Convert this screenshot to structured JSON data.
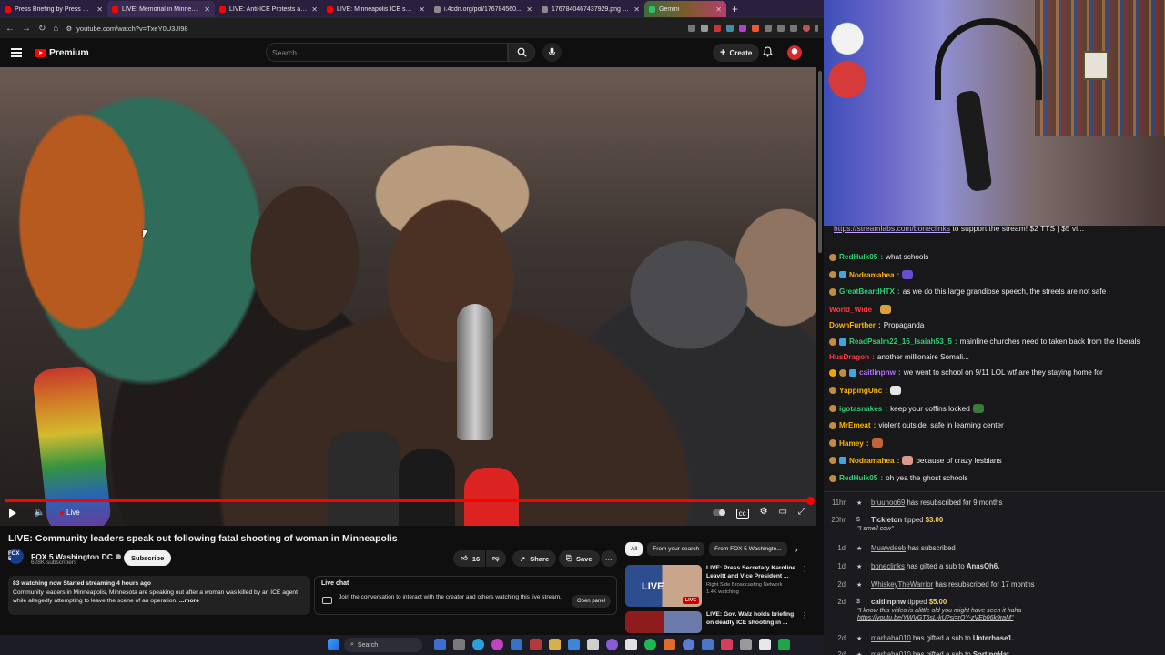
{
  "browser": {
    "tabs": [
      {
        "title": "Press Briefing by Press Secreta...",
        "fav": "red"
      },
      {
        "title": "LIVE: Memorial in Minneapolis",
        "fav": "red"
      },
      {
        "title": "LIVE: Anti-ICE Protests arou...",
        "fav": "red"
      },
      {
        "title": "LIVE: Minneapolis ICE shoo...",
        "fav": "red"
      },
      {
        "title": "i.4cdn.org/pol/176784560...",
        "fav": "grey"
      },
      {
        "title": "1767840467437929.png (1001...",
        "fav": "grey"
      },
      {
        "title": "Gemini",
        "fav": "green"
      }
    ],
    "url": "youtube.com/watch?v=TxeY0U3JI98",
    "window_controls": [
      "—",
      "☐",
      "✕"
    ]
  },
  "header": {
    "logo_text": "Premium",
    "search_placeholder": "Search",
    "create_label": "Create"
  },
  "player": {
    "live_label": "Live"
  },
  "video": {
    "title": "LIVE: Community leaders speak out following fatal shooting of woman in Minneapolis",
    "channel": "FOX 5 Washington DC",
    "channel_logo": "FOX 5",
    "subscribers": "628K subscribers",
    "subscribe_label": "Subscribe",
    "likes": "16",
    "share_label": "Share",
    "save_label": "Save",
    "desc_meta": "83 watching now  Started streaming 4 hours ago",
    "desc_text": "Community leaders in Minneapolis, Minnesota are speaking out after a woman was killed by an ICE agent while allegedly attempting to leave the scene of an operation.",
    "desc_more": "...more",
    "livechat_label": "Live chat",
    "livechat_text": "Join the conversation to interact with the creator and others watching this live stream.",
    "open_panel_label": "Open panel"
  },
  "chips": [
    "All",
    "From your search",
    "From FOX 5 Washingto..."
  ],
  "recommendations": [
    {
      "title": "LIVE: Press Secretary Karoline Leavitt and Vice President ...",
      "channel": "Right Side Broadcasting Network",
      "stat": "1.4K watching",
      "badge": "LIVE"
    },
    {
      "title": "LIVE: Gov. Walz holds briefing on deadly ICE shooting in ...",
      "channel": "",
      "stat": "",
      "badge": ""
    }
  ],
  "stream": {
    "banner_link": "https://streamlabs.com/boneclinks",
    "banner_text": " to support the stream! $2 TTS | $5 vi...",
    "chat": [
      {
        "user": "RedHulk05",
        "color": "#2fd06f",
        "text": "what schools",
        "badges": [
          "round"
        ],
        "emote": ""
      },
      {
        "user": "Nodramahea",
        "color": "#ffb400",
        "text": "",
        "badges": [
          "round",
          "prime"
        ],
        "emote": "#6b4bd1"
      },
      {
        "user": "GreatBeardHTX",
        "color": "#2fd06f",
        "text": "as we do this large grandiose speech, the streets are not safe",
        "badges": [
          "round"
        ],
        "emote": ""
      },
      {
        "user": "World_Wide",
        "color": "#ff3b3b",
        "text": "",
        "badges": [],
        "emote": "#d9a23b"
      },
      {
        "user": "DownFurther",
        "color": "#ffb400",
        "text": "Propaganda",
        "badges": [],
        "emote": ""
      },
      {
        "user": "ReadPsalm22_16_Isaiah53_5",
        "color": "#2fd06f",
        "text": "mainline churches need to taken back from the liberals",
        "badges": [
          "round",
          "prime"
        ],
        "emote": ""
      },
      {
        "user": "HusDragon",
        "color": "#ff3b3b",
        "text": "another millionaire Somali...",
        "badges": [],
        "emote": ""
      },
      {
        "user": "caitlinpnw",
        "color": "#b46cff",
        "text": "we went to school on 9/11 LOL wtf are they staying home for",
        "badges": [
          "gold",
          "round",
          "prime"
        ],
        "emote": ""
      },
      {
        "user": "YappingUnc",
        "color": "#ffb400",
        "text": "",
        "badges": [
          "round"
        ],
        "emote": "#e6e6e6"
      },
      {
        "user": "igotasnakes",
        "color": "#2fd06f",
        "text": "keep your coffins locked",
        "badges": [
          "round"
        ],
        "emote": "#3a7a3a"
      },
      {
        "user": "MrEmeat",
        "color": "#ffb400",
        "text": "violent outside, safe in learning center",
        "badges": [
          "round"
        ],
        "emote": ""
      },
      {
        "user": "Hamey",
        "color": "#ffb400",
        "text": "",
        "badges": [
          "round"
        ],
        "emote": "#c0623a"
      },
      {
        "user": "Nodramahea",
        "color": "#ffb400",
        "text": "because of crazy lesbians",
        "badges": [
          "round",
          "prime"
        ],
        "emote": "#d89a8a"
      },
      {
        "user": "RedHulk05",
        "color": "#2fd06f",
        "text": "oh yea the ghost schools",
        "badges": [
          "round"
        ],
        "emote": ""
      }
    ],
    "events": [
      {
        "age": "11hr",
        "user": "bruunoo69",
        "text": " has resubscribed for 9 months",
        "quote": "",
        "quote2": ""
      },
      {
        "age": "20hr",
        "user": "Tickleton",
        "text": " tipped ",
        "amount": "$3.00",
        "quote": "\"I smell cow\"",
        "quote2": ""
      },
      {
        "age": "1d",
        "user": "Muawdeeb",
        "text": " has subscribed",
        "quote": "",
        "quote2": ""
      },
      {
        "age": "1d",
        "user": "boneclinks",
        "text": " has gifted a sub to ",
        "target": "AnasQh6.",
        "quote": "",
        "quote2": ""
      },
      {
        "age": "2d",
        "user": "WhiskeyTheWarrior",
        "text": " has resubscribed for 17 months",
        "quote": "",
        "quote2": ""
      },
      {
        "age": "2d",
        "user": "caitlinpnw",
        "text": " tipped ",
        "amount": "$5.00",
        "quote": "\"I know this video is alittle old you might have seen it haha",
        "quote2": "https://youtu.be/YWVGT6sL-kU?si=rOY-zVEb06k9raM\""
      },
      {
        "age": "2d",
        "user": "marhaba010",
        "text": " has gifted a sub to ",
        "target": "Unterhose1.",
        "quote": "",
        "quote2": ""
      },
      {
        "age": "2d",
        "user": "marhaba010",
        "text": " has gifted a sub to ",
        "target": "SortingHat",
        "quote": "",
        "quote2": ""
      }
    ]
  },
  "taskbar": {
    "search_label": "Search"
  }
}
